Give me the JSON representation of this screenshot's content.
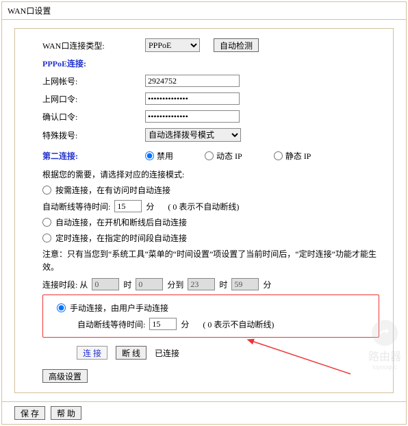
{
  "panel": {
    "title": "WAN口设置"
  },
  "wanType": {
    "label": "WAN口连接类型:",
    "value": "PPPoE",
    "autoDetect": "自动检测"
  },
  "pppoe": {
    "header": "PPPoE连接:"
  },
  "fields": {
    "accountLabel": "上网帐号:",
    "accountValue": "2924752",
    "passwordLabel": "上网口令:",
    "confirmLabel": "确认口令:",
    "dialModeLabel": "特殊拨号:",
    "dialModeValue": "自动选择拨号模式"
  },
  "secondConn": {
    "label": "第二连接:",
    "disable": "禁用",
    "dynamic": "动态 IP",
    "static": "静态 IP"
  },
  "modes": {
    "intro": "根据您的需要，请选择对应的连接模式:",
    "onDemand": "按需连接，在有访问时自动连接",
    "onDemandWait": "自动断线等待时间:",
    "onDemandWaitVal": "15",
    "minUnit": "分",
    "noAutoHint": "( 0 表示不自动断线)",
    "autoConn": "自动连接，在开机和断线后自动连接",
    "scheduled": "定时连接，在指定的时间段自动连接",
    "scheduledNote": "注意：只有当您到“系统工具”菜单的“时间设置”项设置了当前时间后，“定时连接”功能才能生效。",
    "timeSegLabel": "连接时段: 从",
    "hFrom": "0",
    "mFrom": "0",
    "hTo": "23",
    "mTo": "59",
    "hourUnit": "时",
    "toWord": "分到",
    "manual": "手动连接，由用户手动连接",
    "manualWait": "自动断线等待时间:",
    "manualWaitVal": "15"
  },
  "actions": {
    "connect": "连 接",
    "disconnect": "断 线",
    "connected": "已连接",
    "advanced": "高级设置"
  },
  "bottom": {
    "save": "保 存",
    "help": "帮 助"
  },
  "watermark": {
    "brand": "路由器",
    "domain": "luyouqi.c"
  }
}
